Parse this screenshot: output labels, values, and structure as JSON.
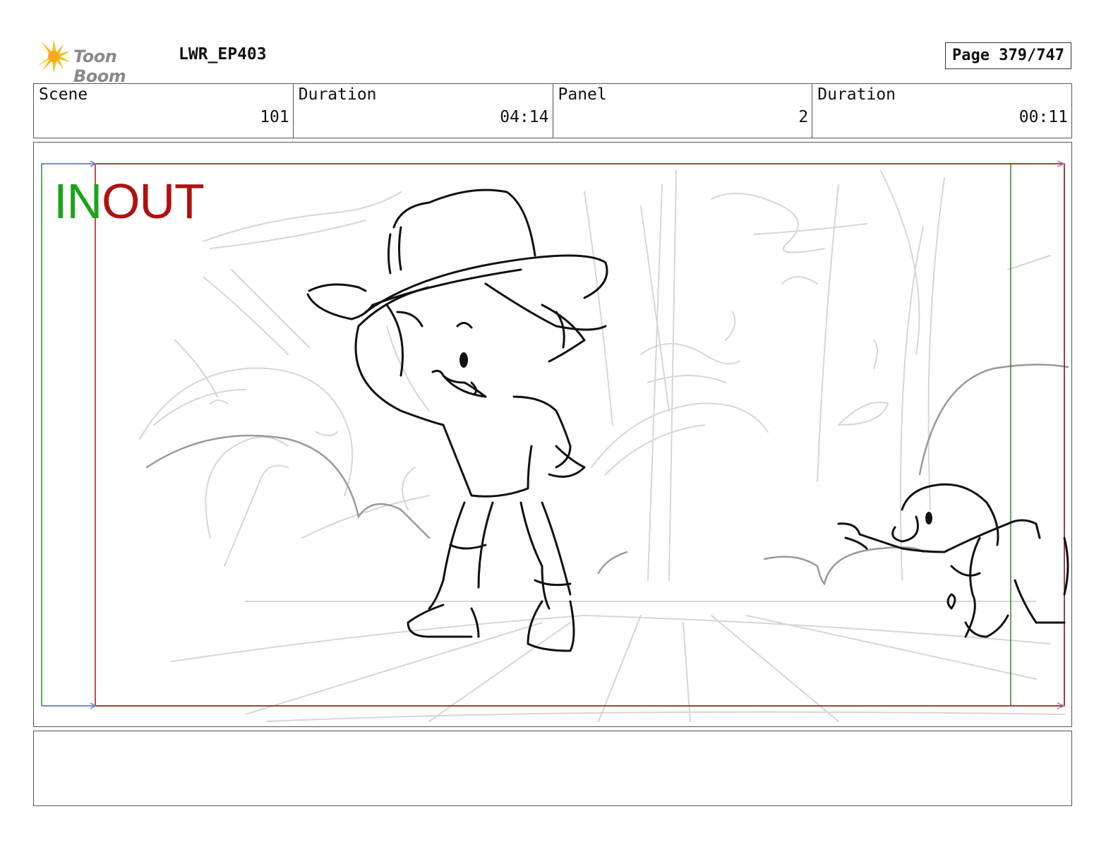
{
  "header": {
    "logo_text": "Toon Boom",
    "logo_icon": "toon-boom-starburst-icon",
    "project_title": "LWR_EP403",
    "page_label": "Page 379/747"
  },
  "info_bar": {
    "scene_label": "Scene",
    "scene_value": "101",
    "scene_duration_label": "Duration",
    "scene_duration_value": "04:14",
    "panel_label": "Panel",
    "panel_value": "2",
    "panel_duration_label": "Duration",
    "panel_duration_value": "00:11"
  },
  "frame": {
    "in_label": "IN",
    "out_label": "OUT",
    "in_color": "#1aa31a",
    "out_color": "#b01010"
  },
  "notes": {
    "text": ""
  }
}
